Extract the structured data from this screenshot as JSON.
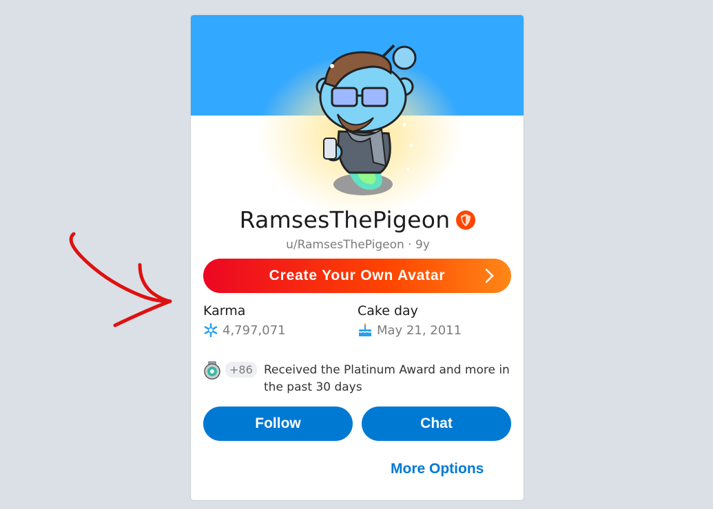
{
  "profile": {
    "username": "RamsesThePigeon",
    "handle": "u/RamsesThePigeon · 9y"
  },
  "create_avatar": {
    "label": "Create Your Own Avatar",
    "icon": "chevron-right-icon"
  },
  "stats": {
    "karma_label": "Karma",
    "karma_value": "4,797,071",
    "karma_icon": "karma-snowflake-icon",
    "cakeday_label": "Cake day",
    "cakeday_value": "May 21, 2011",
    "cakeday_icon": "cake-icon"
  },
  "awards": {
    "icon": "platinum-award-icon",
    "count": "+86",
    "text": "Received the Platinum Award and more in the past 30 days"
  },
  "actions": {
    "follow_label": "Follow",
    "chat_label": "Chat",
    "more_options_label": "More Options"
  },
  "colors": {
    "banner": "#33a8ff",
    "primary_button": "#0079d3",
    "gradient_start": "#ec0623",
    "gradient_end": "#ff8717",
    "annotation_arrow": "#e01010",
    "page_background": "#dae0e6"
  }
}
